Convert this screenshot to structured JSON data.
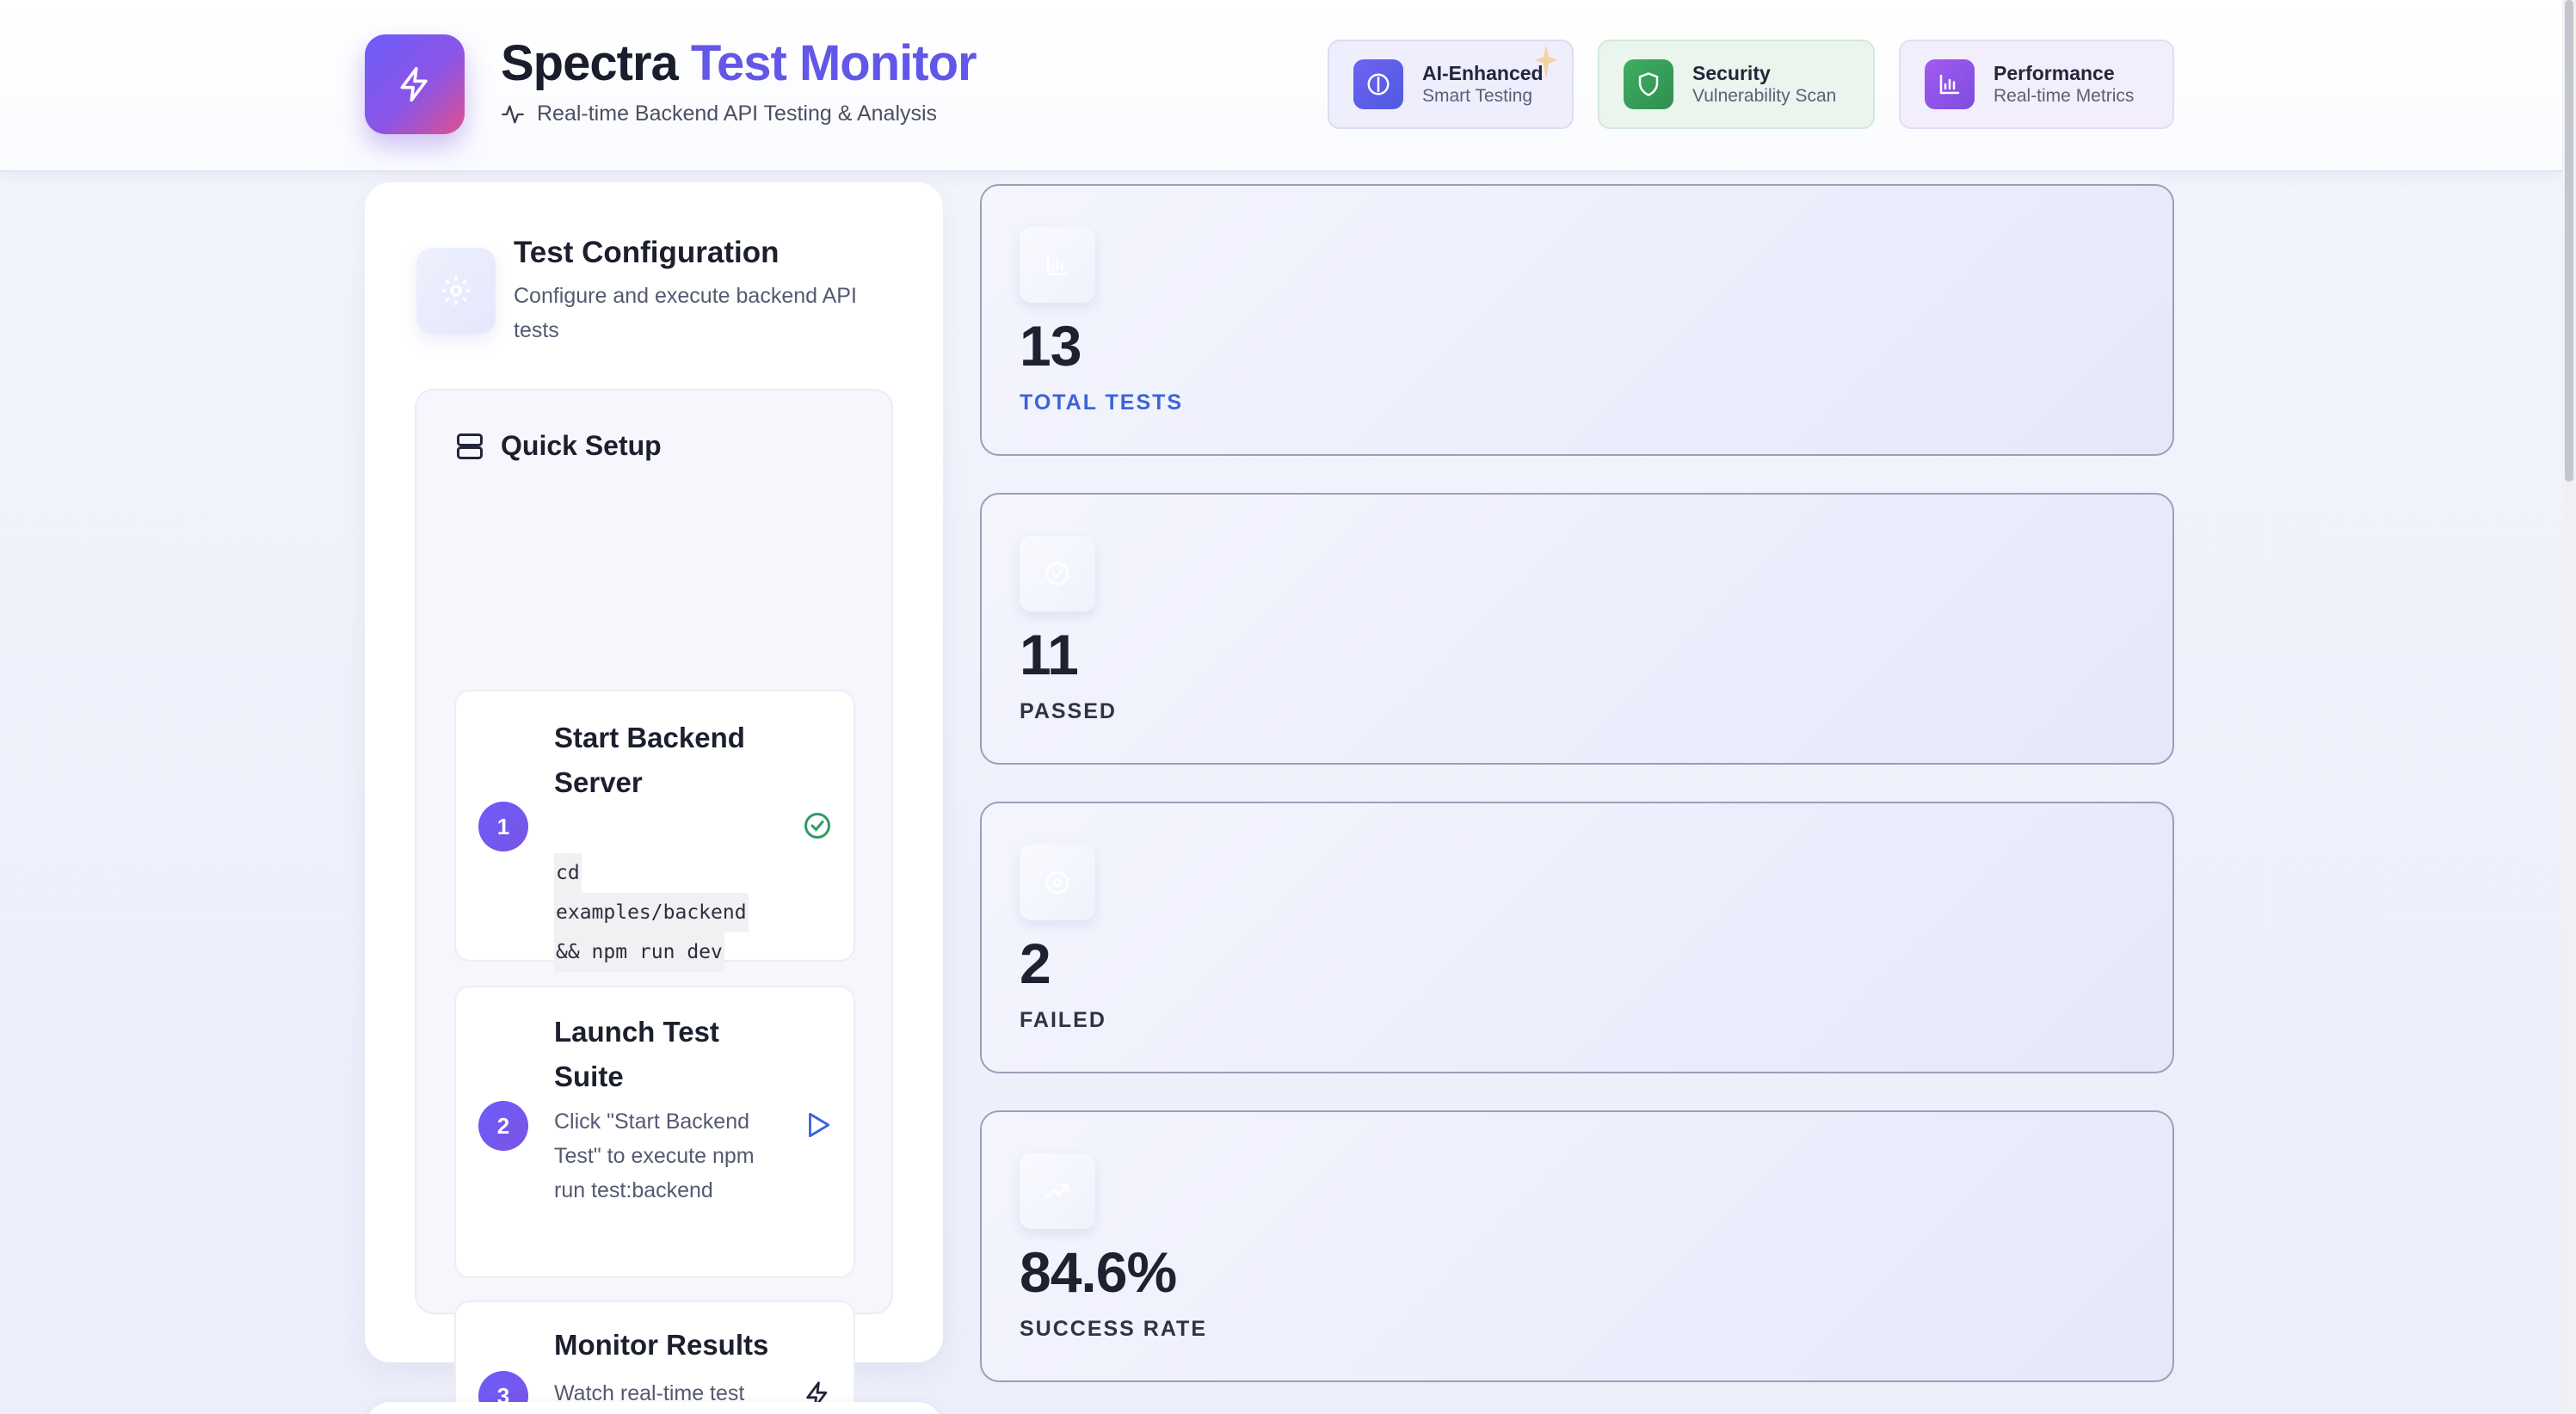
{
  "header": {
    "brand_primary": "Spectra",
    "brand_accent": "Test Monitor",
    "subtitle": "Real-time Backend API Testing & Analysis",
    "accent_color": "#6257e6",
    "logo_icon": "lightning-bolt-icon",
    "features": [
      {
        "title": "AI-Enhanced",
        "subtitle": "Smart Testing",
        "icon": "brain-icon"
      },
      {
        "title": "Security",
        "subtitle": "Vulnerability Scan",
        "icon": "shield-icon"
      },
      {
        "title": "Performance",
        "subtitle": "Real-time Metrics",
        "icon": "bar-chart-icon"
      }
    ]
  },
  "config": {
    "title": "Test Configuration",
    "description": "Configure and execute backend API tests",
    "icon": "gear-icon",
    "quick_setup": {
      "title": "Quick Setup",
      "icon": "server-icon",
      "steps": [
        {
          "number": "1",
          "title": "Start Backend Server",
          "code_lines": [
            "cd",
            "examples/backend",
            "&& npm run dev"
          ],
          "status_icon": "check-circle-icon"
        },
        {
          "number": "2",
          "title": "Launch Test Suite",
          "description": "Click \"Start Backend Test\" to execute npm run test:backend",
          "status_icon": "play-icon"
        },
        {
          "number": "3",
          "title": "Monitor Results",
          "description": "Watch real-time test execution and results",
          "status_icon": "lightning-icon"
        }
      ]
    }
  },
  "stats": [
    {
      "value": "13",
      "label": "TOTAL TESTS",
      "icon": "bar-chart-icon"
    },
    {
      "value": "11",
      "label": "PASSED",
      "icon": "check-circle-icon"
    },
    {
      "value": "2",
      "label": "FAILED",
      "icon": "x-circle-icon"
    },
    {
      "value": "84.6%",
      "label": "SUCCESS RATE",
      "icon": "trending-up-icon"
    }
  ]
}
